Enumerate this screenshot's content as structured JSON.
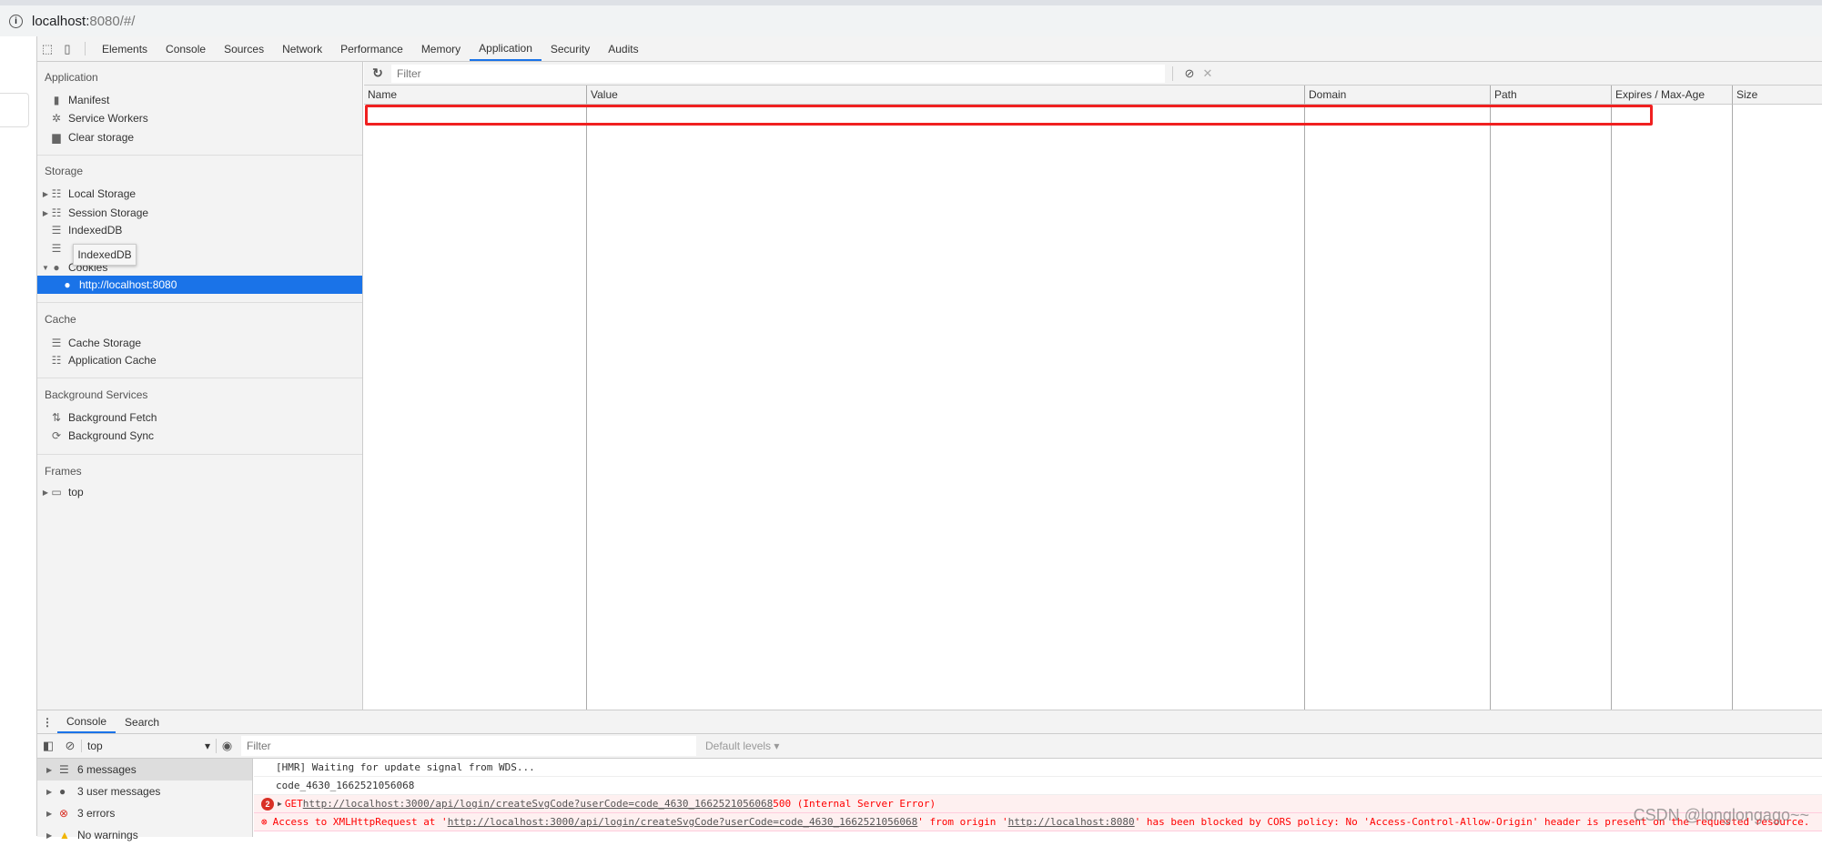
{
  "browser": {
    "url_host": "localhost:",
    "url_rest": "8080/#/"
  },
  "devtools": {
    "tabs": [
      "Elements",
      "Console",
      "Sources",
      "Network",
      "Performance",
      "Memory",
      "Application",
      "Security",
      "Audits"
    ],
    "active_tab": "Application"
  },
  "sidebar": {
    "application": {
      "title": "Application",
      "items": [
        "Manifest",
        "Service Workers",
        "Clear storage"
      ]
    },
    "storage": {
      "title": "Storage",
      "items": [
        "Local Storage",
        "Session Storage",
        "IndexedDB",
        "",
        "Cookies"
      ],
      "selected": "http://localhost:8080"
    },
    "tooltip": "IndexedDB",
    "cache": {
      "title": "Cache",
      "items": [
        "Cache Storage",
        "Application Cache"
      ]
    },
    "background": {
      "title": "Background Services",
      "items": [
        "Background Fetch",
        "Background Sync"
      ]
    },
    "frames": {
      "title": "Frames",
      "items": [
        "top"
      ]
    }
  },
  "cookies": {
    "filter_placeholder": "Filter",
    "columns": [
      "Name",
      "Value",
      "Domain",
      "Path",
      "Expires / Max-Age",
      "Size"
    ],
    "rows": []
  },
  "drawer": {
    "tabs": [
      "Console",
      "Search"
    ],
    "active_tab": "Console",
    "context": "top",
    "filter_placeholder": "Filter",
    "levels": "Default levels ▾",
    "sidebar": [
      "6 messages",
      "3 user messages",
      "3 errors",
      "No warnings"
    ],
    "messages": [
      {
        "text": "[HMR] Waiting for update signal from WDS..."
      },
      {
        "text": "code_4630_1662521056068"
      },
      {
        "count": "2",
        "prefix": "GET ",
        "url": "http://localhost:3000/api/login/createSvgCode?userCode=code_4630_1662521056068",
        "suffix": " 500 (Internal Server Error)"
      },
      {
        "prefix": "Access to XMLHttpRequest at '",
        "url": "http://localhost:3000/api/login/createSvgCode?userCode=code_4630_1662521056068",
        "mid": "' from origin '",
        "url2": "http://localhost:8080",
        "suffix": "' has been blocked by CORS policy: No 'Access-Control-Allow-Origin' header is present on the requested resource."
      }
    ]
  },
  "watermark": "CSDN @longlongago~~",
  "colors": {
    "accent": "#1a73e8",
    "error": "#ff0000",
    "highlight_box": "#f02020"
  }
}
